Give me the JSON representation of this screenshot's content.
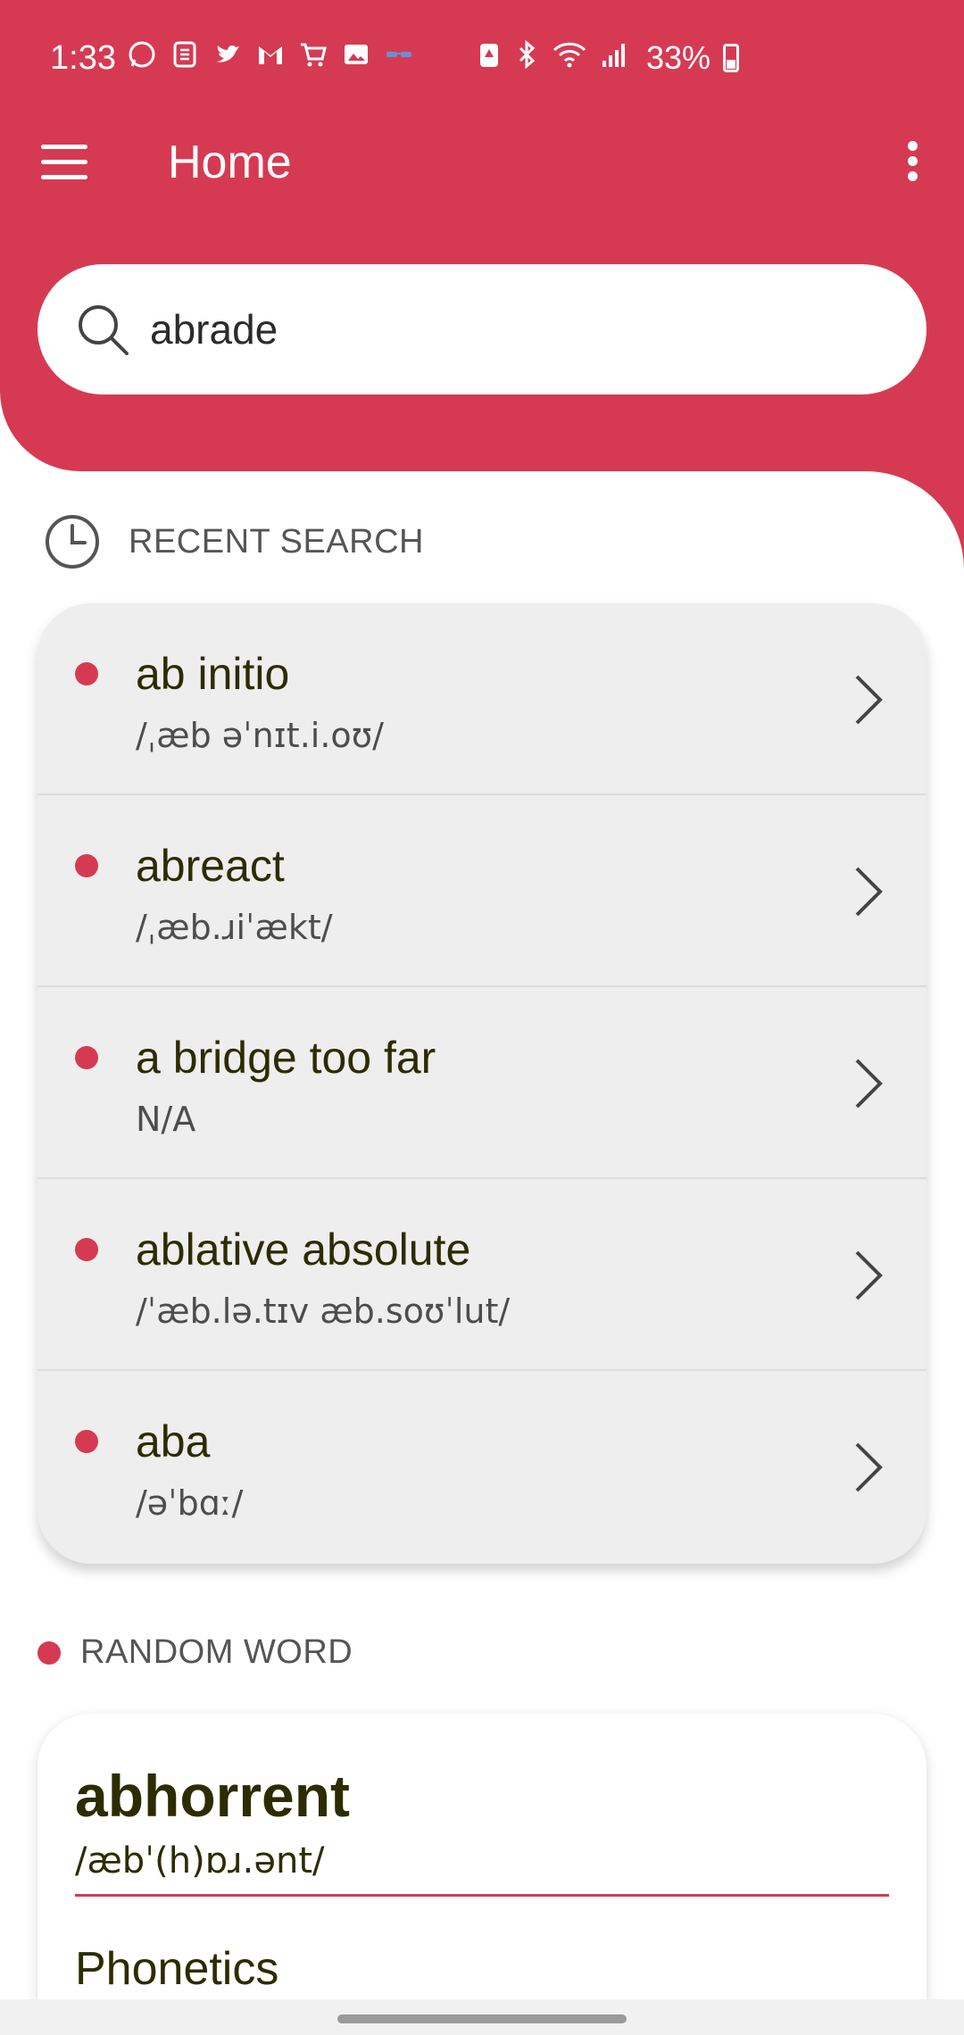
{
  "status_bar": {
    "time": "1:33",
    "battery": "33%",
    "left_icons": [
      "whatsapp-icon",
      "s-icon",
      "twitter-icon",
      "gmail-icon",
      "cart-icon",
      "image-icon",
      "glasses-icon"
    ],
    "right_icons": [
      "battery-saver-icon",
      "bluetooth-icon",
      "wifi-icon",
      "signal-icon"
    ]
  },
  "app_bar": {
    "title": "Home"
  },
  "search": {
    "value": "abrade",
    "placeholder": ""
  },
  "recent": {
    "title": "RECENT SEARCH",
    "items": [
      {
        "word": "ab initio",
        "phonetic": "/ˌæb əˈnɪt.i.oʊ/"
      },
      {
        "word": "abreact",
        "phonetic": "/ˌæb.ɹiˈækt/"
      },
      {
        "word": "a bridge too far",
        "phonetic": "N/A"
      },
      {
        "word": "ablative absolute",
        "phonetic": "/ˈæb.lə.tɪv æb.soʊˈlut/"
      },
      {
        "word": "aba",
        "phonetic": "/əˈbɑː/"
      }
    ]
  },
  "random": {
    "title": "RANDOM WORD",
    "word": "abhorrent",
    "phonetic": "/æbˈ(h)ɒɹ.ənt/",
    "section": "Phonetics"
  },
  "colors": {
    "accent": "#d63a52",
    "text_dark": "#2c2c00",
    "card_bg": "#eeeeee"
  }
}
